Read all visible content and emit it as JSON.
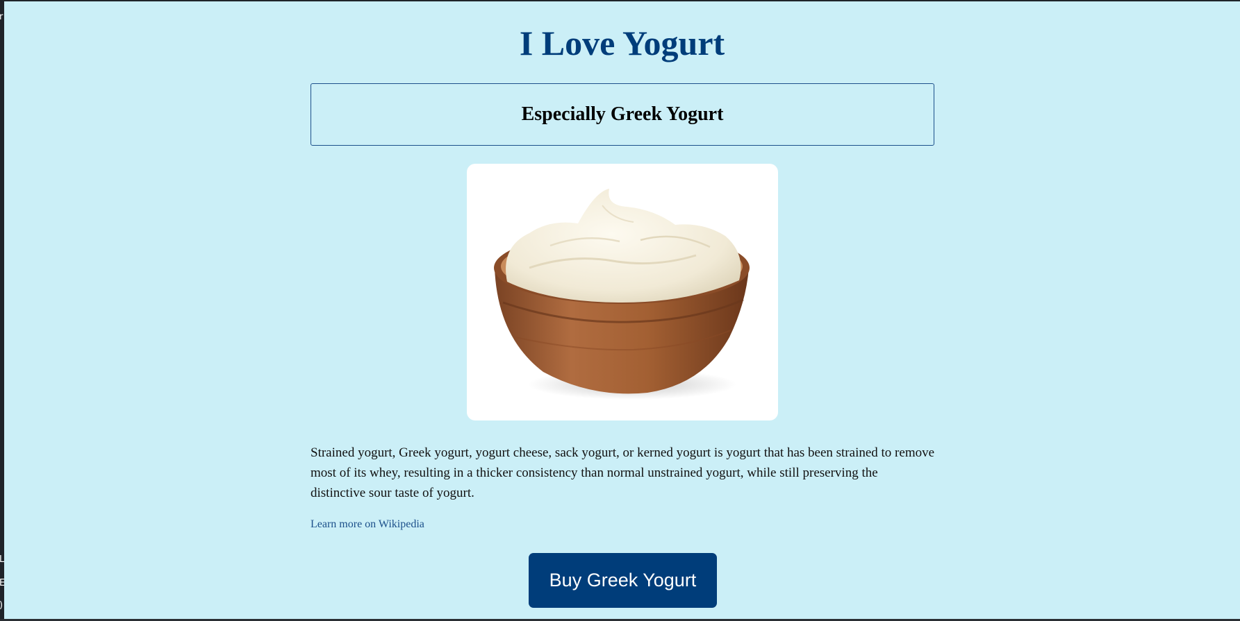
{
  "page": {
    "title": "I Love Yogurt",
    "subtitle": "Especially Greek Yogurt",
    "description": "Strained yogurt, Greek yogurt, yogurt cheese, sack yogurt, or kerned yogurt is yogurt that has been strained to remove most of its whey, resulting in a thicker consistency than normal unstrained yogurt, while still preserving the distinctive sour taste of yogurt.",
    "link_text": "Learn more on Wikipedia",
    "button_label": "Buy Greek Yogurt"
  },
  "left_strip_glyphs": [
    "r",
    "L",
    "E",
    ")"
  ],
  "colors": {
    "page_background": "#cbeff7",
    "accent": "#003d7a",
    "link": "#1b4f8a",
    "button_text": "#ffffff"
  }
}
